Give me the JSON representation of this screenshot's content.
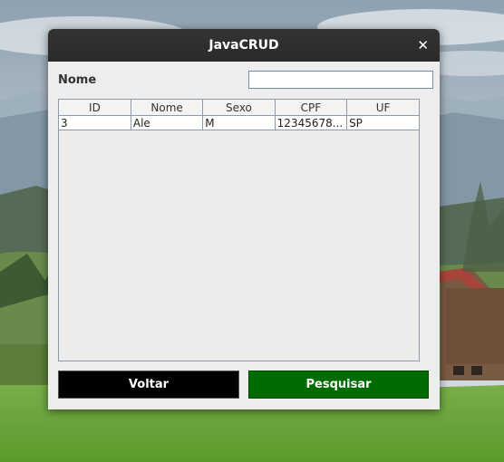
{
  "window": {
    "title": "JavaCRUD",
    "close_label": "✕"
  },
  "search": {
    "label": "Nome",
    "value": "",
    "placeholder": ""
  },
  "table": {
    "columns": [
      "ID",
      "Nome",
      "Sexo",
      "CPF",
      "UF"
    ],
    "rows": [
      [
        "3",
        "Ale",
        "M",
        "12345678...",
        "SP"
      ]
    ]
  },
  "buttons": {
    "back_label": "Voltar",
    "search_label": "Pesquisar"
  },
  "colors": {
    "back_button": "#000000",
    "search_button": "#006b00",
    "titlebar": "#2f2f2f"
  }
}
